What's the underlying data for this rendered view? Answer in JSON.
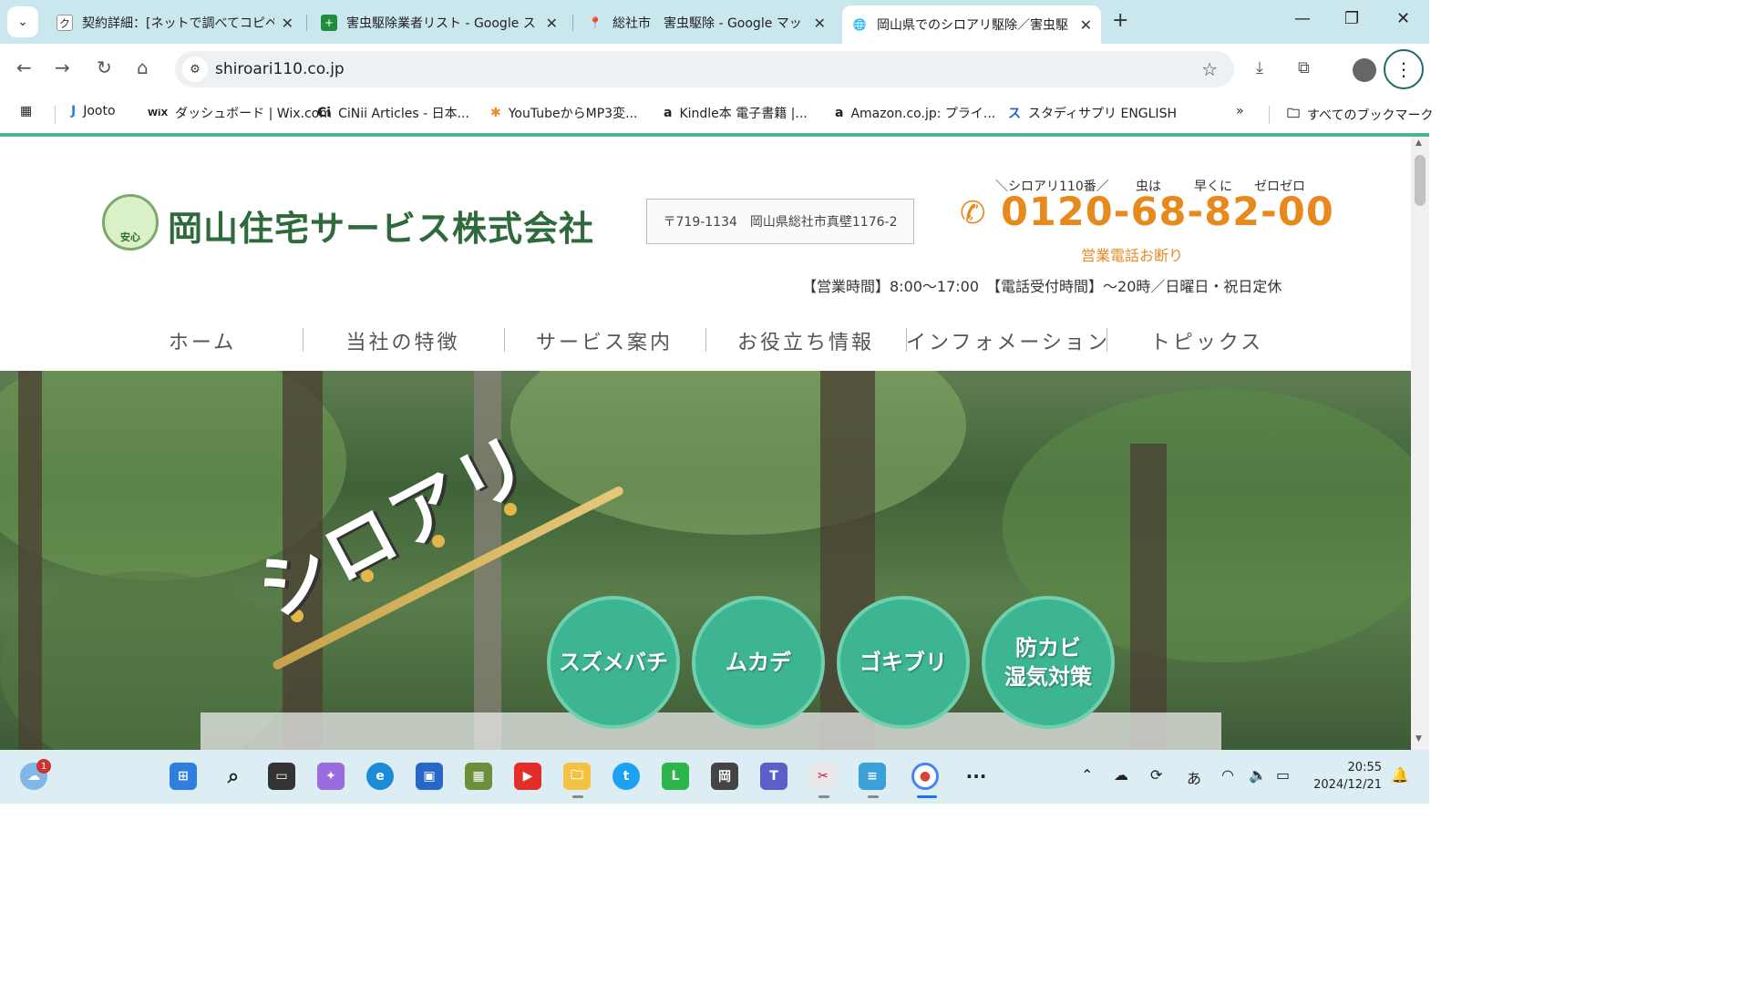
{
  "browser": {
    "tabs": [
      {
        "title": "契約詳細：[ネットで調べてコピペす",
        "favicon": "ク"
      },
      {
        "title": "害虫駆除業者リスト - Google ス",
        "favicon": "+"
      },
      {
        "title": "総社市　害虫駆除 - Google マッ",
        "favicon": "📍"
      },
      {
        "title": "岡山県でのシロアリ駆除／害虫駆",
        "favicon": "🌐"
      }
    ],
    "url": "shiroari110.co.jp",
    "bookmarks": [
      {
        "label": "Jooto",
        "icon": "J"
      },
      {
        "label": "ダッシュボード | Wix.com",
        "icon": "WiX"
      },
      {
        "label": "CiNii Articles - 日本...",
        "icon": "Ci"
      },
      {
        "label": "YouTubeからMP3変...",
        "icon": "✱"
      },
      {
        "label": "Kindle本 電子書籍 |...",
        "icon": "a"
      },
      {
        "label": "Amazon.co.jp: プライ...",
        "icon": "a"
      },
      {
        "label": "スタディサプリ ENGLISH",
        "icon": "ス"
      }
    ],
    "all_bookmarks": "すべてのブックマーク"
  },
  "site": {
    "logo_badge": "安心",
    "company": "岡山住宅サービス株式会社",
    "address": "〒719-1134　岡山県総社市真壁1176-2",
    "tagline": {
      "a": "＼シロアリ110番／",
      "b": "虫は",
      "c": "早くに",
      "d": "ゼロゼロ"
    },
    "phone": "0120-68-82-00",
    "no_sales": "営業電話お断り",
    "hours": "【営業時間】8:00～17:00　【電話受付時間】～20時／日曜日・祝日定休",
    "nav": [
      "ホーム",
      "当社の特徴",
      "サービス案内",
      "お役立ち情報",
      "インフォメーション",
      "トピックス"
    ],
    "hero_title": "シロアリ",
    "bubbles": [
      "スズメバチ",
      "ムカデ",
      "ゴキブリ",
      "防カビ\n湿気対策"
    ]
  },
  "taskbar": {
    "notification_count": "1",
    "time": "20:55",
    "date": "2024/12/21",
    "ime": "あ"
  }
}
